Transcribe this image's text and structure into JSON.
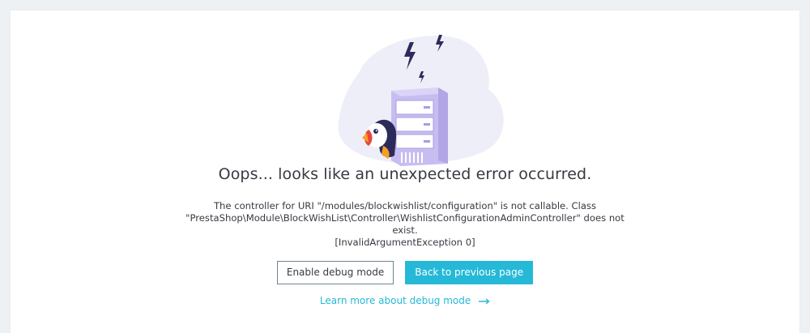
{
  "error": {
    "title": "Oops... looks like an unexpected error occurred.",
    "message_line1": "The controller for URI \"/modules/blockwishlist/configuration\" is not callable. Class \"PrestaShop\\Module\\BlockWishList\\Controller\\WishlistConfigurationAdminController\" does not",
    "message_line2": "exist.",
    "exception": "[InvalidArgumentException 0]"
  },
  "actions": {
    "debug_label": "Enable debug mode",
    "back_label": "Back to previous page",
    "learn_more_label": "Learn more about debug mode"
  },
  "icons": {
    "illustration": "puffin-server-illustration",
    "lightning": "lightning-icon",
    "arrow": "arrow-right-icon"
  },
  "colors": {
    "accent": "#25b9d7",
    "text": "#363a41",
    "server": "#c8bdf0",
    "blob": "#eeeef8",
    "lightning": "#2d2a5c"
  }
}
